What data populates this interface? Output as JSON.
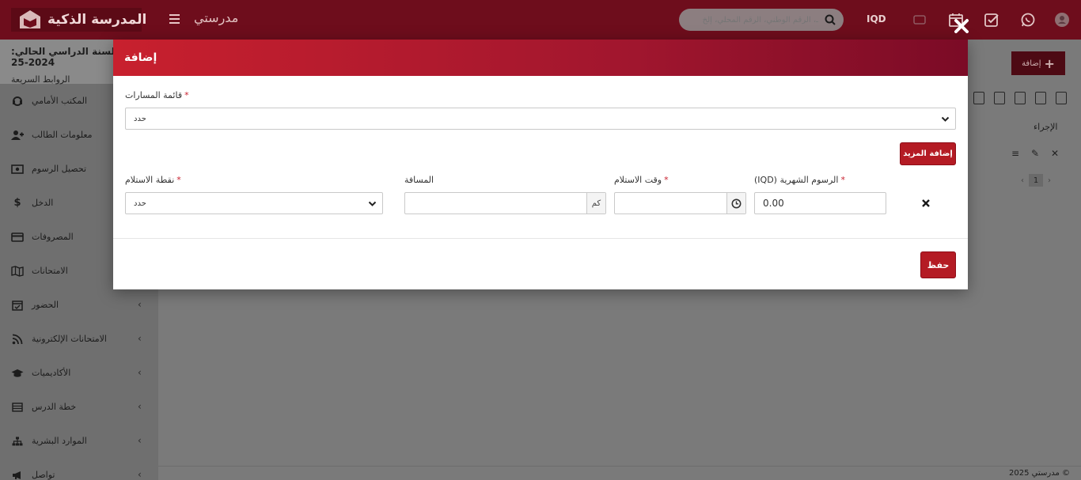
{
  "header": {
    "logo_text": "المدرسة الذكية",
    "brand_title": "مدرستي",
    "search_placeholder": "ـ، الرقم الوطني، الرقم المحلي، إلخ",
    "currency": "IQD"
  },
  "sidebar": {
    "current_year": "السنة الدراسي الحالي: 2024-25",
    "quick_links": "الروابط السريعة",
    "items": [
      {
        "label": "المكتب الأمامي",
        "icon": "headset-icon"
      },
      {
        "label": "معلومات الطالب",
        "icon": "user-plus-icon"
      },
      {
        "label": "تحصيل الرسوم",
        "icon": "money-icon"
      },
      {
        "label": "الدخل",
        "icon": "dollar-icon"
      },
      {
        "label": "المصروفات",
        "icon": "credit-card-icon"
      },
      {
        "label": "الامتحانات",
        "icon": "map-icon"
      },
      {
        "label": "الحضور",
        "icon": "calendar-icon"
      },
      {
        "label": "الامتحانات الإلكترونية",
        "icon": "rss-icon"
      },
      {
        "label": "الأكاديميات",
        "icon": "graduation-cap-icon"
      },
      {
        "label": "خطة الدرس",
        "icon": "list-icon"
      },
      {
        "label": "الموارد البشرية",
        "icon": "sitemap-icon"
      },
      {
        "label": "تواصل",
        "icon": "bullhorn-icon"
      }
    ]
  },
  "background": {
    "add_label": "إضافة",
    "action_header": "الإجراء",
    "page_number": "1",
    "footer": "مدرستي 2025 ©"
  },
  "modal": {
    "title": "إضافة",
    "route_list_label": "قائمة المسارات",
    "route_list_value": "حدد",
    "add_more_label": "إضافة المزيد",
    "pickup_point_label": "نقطة الاستلام",
    "pickup_point_value": "حدد",
    "distance_label": "المسافة",
    "distance_unit": "كم",
    "pickup_time_label": "وقت الاستلام",
    "monthly_fees_label": "(IQD) الرسوم الشهرية",
    "monthly_fees_value": "0.00",
    "save_label": "حفظ"
  },
  "colors": {
    "primary": "#b41b24",
    "header_dark": "#6e0d1c"
  }
}
